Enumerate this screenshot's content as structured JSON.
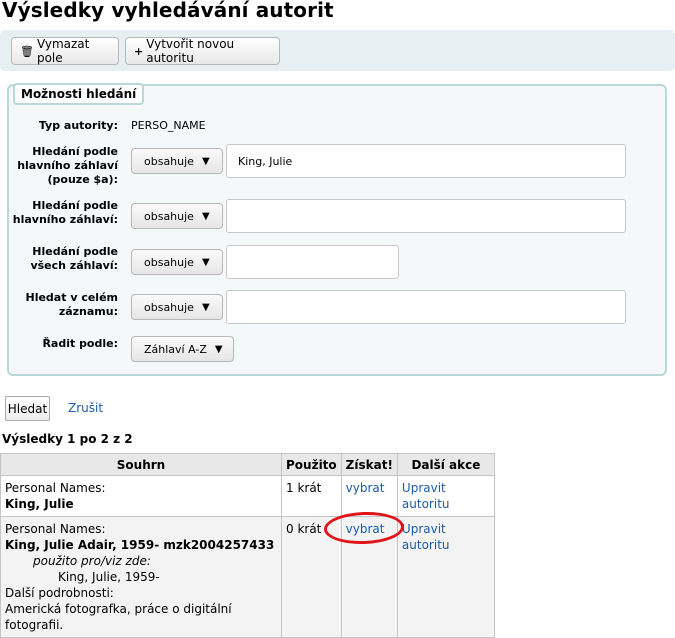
{
  "page": {
    "title": "Výsledky vyhledávání autorit"
  },
  "toolbar": {
    "clear_label": "Vymazat pole",
    "clear_icon": "trash-icon",
    "new_label": "Vytvořit novou autoritu",
    "new_icon": "plus-icon"
  },
  "search_options": {
    "legend": "Možnosti hledání",
    "authority_type_label": "Typ autority:",
    "authority_type_value": "PERSO_NAME",
    "main_heading_a_label": "Hledání podle hlavního záhlaví (pouze $a):",
    "main_heading_a_operator": "obsahuje",
    "main_heading_a_value": "King, Julie",
    "main_heading_label": "Hledání podle hlavního záhlaví:",
    "main_heading_operator": "obsahuje",
    "main_heading_value": "",
    "all_headings_label": "Hledání podle všech záhlaví:",
    "all_headings_operator": "obsahuje",
    "all_headings_value": "",
    "whole_record_label": "Hledat v celém záznamu:",
    "whole_record_operator": "obsahuje",
    "whole_record_value": "",
    "sort_label": "Řadit podle:",
    "sort_value": "Záhlaví A-Z"
  },
  "actions": {
    "search_label": "Hledat",
    "cancel_label": "Zrušit"
  },
  "results": {
    "count_text": "Výsledky 1 po 2 z 2",
    "headers": [
      "Souhrn",
      "Použito",
      "Získat!",
      "Další akce"
    ],
    "rows": [
      {
        "type": "Personal Names:",
        "heading": "King, Julie",
        "used": "1 krát",
        "get": "vybrat",
        "action": "Upravit autoritu"
      },
      {
        "type": "Personal Names:",
        "heading": "King, Julie Adair, 1959- mzk2004257433",
        "see_from_label": "použito pro/viz zde:",
        "see_from_value": "King, Julie, 1959-",
        "more_label": "Další podrobnosti:",
        "more_value": "Americká fotografka, práce o digitální fotografii.",
        "used": "0 krát",
        "get": "vybrat",
        "action": "Upravit autoritu"
      }
    ]
  },
  "colors": {
    "link": "#1c5aa8",
    "annotation": "#e0141b",
    "toolbar_bg": "#e6f0f2",
    "fieldset_border": "#b9d8d9"
  }
}
